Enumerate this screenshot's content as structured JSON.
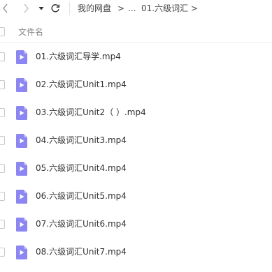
{
  "toolbar": {
    "back_icon": "chevron-left-icon",
    "forward_icon": "chevron-right-icon",
    "dropdown_icon": "caret-down-icon",
    "refresh_icon": "refresh-icon"
  },
  "breadcrumb": {
    "root": "我的网盘",
    "sep1": ">",
    "ellipsis": "...",
    "current": "01.六级词汇",
    "sep2": ">"
  },
  "table": {
    "column_name": "文件名"
  },
  "files": [
    {
      "name": "01.六级词汇导学.mp4",
      "type_icon": "video-file-icon"
    },
    {
      "name": "02.六级词汇Unit1.mp4",
      "type_icon": "video-file-icon"
    },
    {
      "name": "03.六级词汇Unit2（ ）.mp4",
      "type_icon": "video-file-icon"
    },
    {
      "name": "04.六级词汇Unit3.mp4",
      "type_icon": "video-file-icon"
    },
    {
      "name": "05.六级词汇Unit4.mp4",
      "type_icon": "video-file-icon"
    },
    {
      "name": "06.六级词汇Unit5.mp4",
      "type_icon": "video-file-icon"
    },
    {
      "name": "07.六级词汇Unit6.mp4",
      "type_icon": "video-file-icon"
    },
    {
      "name": "08.六级词汇Unit7.mp4",
      "type_icon": "video-file-icon"
    }
  ],
  "colors": {
    "file_icon": "#8c86f2",
    "file_icon_fold": "#b7b3f7",
    "text": "#333333",
    "header_text": "#888888"
  }
}
